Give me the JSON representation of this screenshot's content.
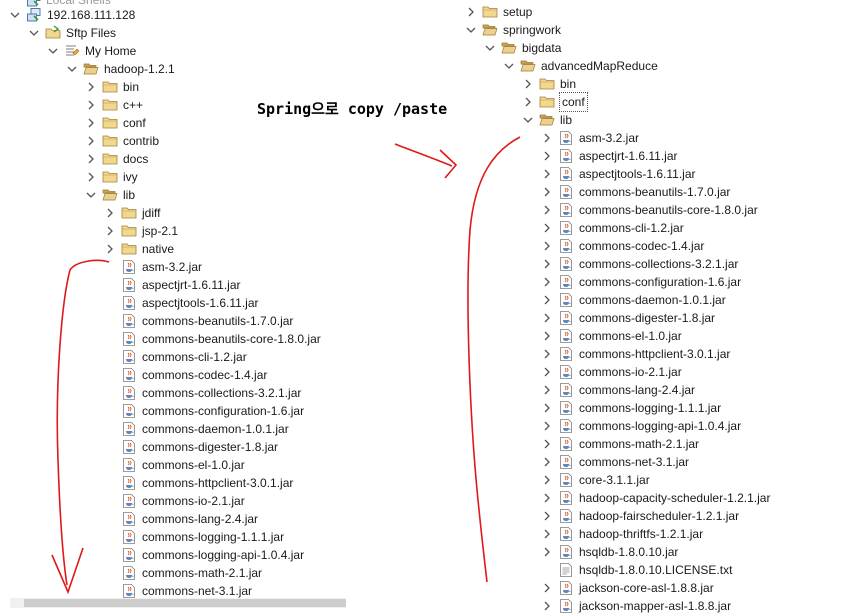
{
  "left_tree": {
    "partial_top_label": "Local Shells",
    "host": "192.168.111.128",
    "sftp_files": "Sftp Files",
    "my_home": "My Home",
    "hadoop_folder": "hadoop-1.2.1",
    "hadoop_children": [
      "bin",
      "c++",
      "conf",
      "contrib",
      "docs",
      "ivy"
    ],
    "lib_folder": "lib",
    "lib_subfolders": [
      "jdiff",
      "jsp-2.1",
      "native"
    ],
    "jars": [
      "asm-3.2.jar",
      "aspectjrt-1.6.11.jar",
      "aspectjtools-1.6.11.jar",
      "commons-beanutils-1.7.0.jar",
      "commons-beanutils-core-1.8.0.jar",
      "commons-cli-1.2.jar",
      "commons-codec-1.4.jar",
      "commons-collections-3.2.1.jar",
      "commons-configuration-1.6.jar",
      "commons-daemon-1.0.1.jar",
      "commons-digester-1.8.jar",
      "commons-el-1.0.jar",
      "commons-httpclient-3.0.1.jar",
      "commons-io-2.1.jar",
      "commons-lang-2.4.jar",
      "commons-logging-1.1.1.jar",
      "commons-logging-api-1.0.4.jar",
      "commons-math-2.1.jar",
      "commons-net-3.1.jar"
    ]
  },
  "right_tree": {
    "setup": "setup",
    "springwork": "springwork",
    "bigdata": "bigdata",
    "advanced": "advancedMapReduce",
    "bin": "bin",
    "conf": "conf",
    "lib": "lib",
    "files": [
      "asm-3.2.jar",
      "aspectjrt-1.6.11.jar",
      "aspectjtools-1.6.11.jar",
      "commons-beanutils-1.7.0.jar",
      "commons-beanutils-core-1.8.0.jar",
      "commons-cli-1.2.jar",
      "commons-codec-1.4.jar",
      "commons-collections-3.2.1.jar",
      "commons-configuration-1.6.jar",
      "commons-daemon-1.0.1.jar",
      "commons-digester-1.8.jar",
      "commons-el-1.0.jar",
      "commons-httpclient-3.0.1.jar",
      "commons-io-2.1.jar",
      "commons-lang-2.4.jar",
      "commons-logging-1.1.1.jar",
      "commons-logging-api-1.0.4.jar",
      "commons-math-2.1.jar",
      "commons-net-3.1.jar",
      "core-3.1.1.jar",
      "hadoop-capacity-scheduler-1.2.1.jar",
      "hadoop-fairscheduler-1.2.1.jar",
      "hadoop-thriftfs-1.2.1.jar",
      "hsqldb-1.8.0.10.jar",
      "hsqldb-1.8.0.10.LICENSE.txt",
      "jackson-core-asl-1.8.8.jar",
      "jackson-mapper-asl-1.8.8.jar"
    ]
  },
  "annotation": "Spring으로 copy /paste",
  "colors": {
    "folder": "#dcb67a",
    "ink": "#e01919",
    "chevron": "#555555"
  }
}
